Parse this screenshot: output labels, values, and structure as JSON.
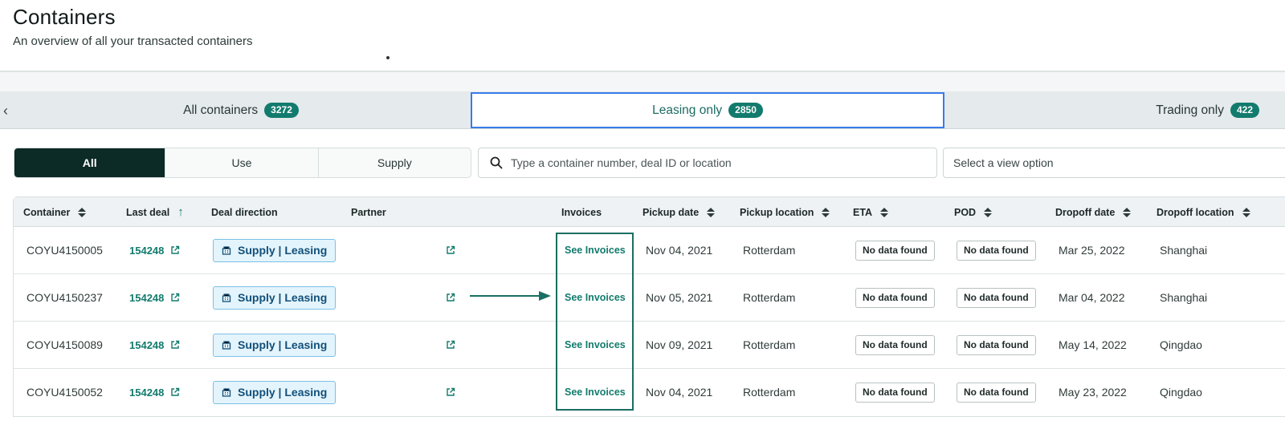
{
  "header": {
    "title": "Containers",
    "subtitle": "An overview of all your transacted containers"
  },
  "tabs": [
    {
      "label": "All containers",
      "count": "3272",
      "active": false
    },
    {
      "label": "Leasing only",
      "count": "2850",
      "active": true
    },
    {
      "label": "Trading only",
      "count": "422",
      "active": false
    }
  ],
  "filter": {
    "segments": [
      "All",
      "Use",
      "Supply"
    ],
    "active_segment": "All",
    "search_placeholder": "Type a container number, deal ID or location",
    "view_placeholder": "Select a view option"
  },
  "table": {
    "columns": [
      "Container",
      "Last deal",
      "Deal direction",
      "Partner",
      "Invoices",
      "Pickup date",
      "Pickup location",
      "ETA",
      "POD",
      "Dropoff date",
      "Dropoff location"
    ],
    "sort_state": {
      "Last deal": "ascending"
    },
    "rows": [
      {
        "container": "COYU4150005",
        "last_deal": "154248",
        "deal_direction": "Supply | Leasing",
        "partner": "",
        "invoices": "See Invoices",
        "pickup_date": "Nov 04, 2021",
        "pickup_location": "Rotterdam",
        "eta": "No data found",
        "pod": "No data found",
        "dropoff_date": "Mar 25, 2022",
        "dropoff_location": "Shanghai"
      },
      {
        "container": "COYU4150237",
        "last_deal": "154248",
        "deal_direction": "Supply | Leasing",
        "partner": "",
        "invoices": "See Invoices",
        "pickup_date": "Nov 05, 2021",
        "pickup_location": "Rotterdam",
        "eta": "No data found",
        "pod": "No data found",
        "dropoff_date": "Mar 04, 2022",
        "dropoff_location": "Shanghai"
      },
      {
        "container": "COYU4150089",
        "last_deal": "154248",
        "deal_direction": "Supply | Leasing",
        "partner": "",
        "invoices": "See Invoices",
        "pickup_date": "Nov 09, 2021",
        "pickup_location": "Rotterdam",
        "eta": "No data found",
        "pod": "No data found",
        "dropoff_date": "May 14, 2022",
        "dropoff_location": "Qingdao"
      },
      {
        "container": "COYU4150052",
        "last_deal": "154248",
        "deal_direction": "Supply | Leasing",
        "partner": "",
        "invoices": "See Invoices",
        "pickup_date": "Nov 04, 2021",
        "pickup_location": "Rotterdam",
        "eta": "No data found",
        "pod": "No data found",
        "dropoff_date": "May 23, 2022",
        "dropoff_location": "Qingdao"
      }
    ]
  },
  "icons": {
    "tab_back": "chevron-left-icon",
    "search": "search-icon",
    "sort": "sort-icon",
    "sort_asc": "arrow-up-icon",
    "external_link": "external-link-icon",
    "deal_direction": "building-icon"
  },
  "colors": {
    "accent": "#127b6d",
    "active_segment": "#0c2a26",
    "active_tab_border": "#3a7be8",
    "deal_tag_bg": "#e4f4fc",
    "deal_tag_border": "#7cc0e6",
    "annotation": "#1b6e62"
  }
}
